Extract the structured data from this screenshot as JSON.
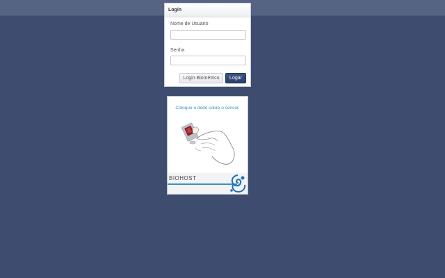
{
  "login": {
    "header_title": "Login",
    "username_label": "Nome de Usuário",
    "username_value": "",
    "username_placeholder": "",
    "password_label": "Senha",
    "password_value": "",
    "password_placeholder": "",
    "biometric_button": "Login Biométrico",
    "login_button": "Logar"
  },
  "sensor": {
    "instruction": "Coloque o dedo sobre o sensor.",
    "brand": "BIOHOST",
    "illustration_icon": "hand-on-fingerprint-sensor-icon",
    "logo_icon": "swirl-logo-icon"
  },
  "colors": {
    "background": "#3e4d6f",
    "topbar": "#566483",
    "primary_button": "#2e4370",
    "accent_blue": "#3a8fc0"
  }
}
